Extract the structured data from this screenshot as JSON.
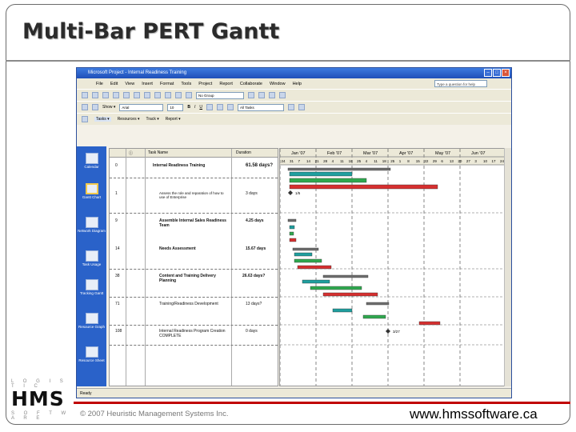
{
  "slide": {
    "title": "Multi-Bar PERT Gantt",
    "copyright": "© 2007 Heuristic Management Systems Inc.",
    "website": "www.hmssoftware.ca",
    "logo": {
      "top": "L O G I S T I C",
      "name": "HMS",
      "bottom": "S O F T W A R E"
    }
  },
  "app": {
    "title": "Microsoft Project - Internal Readiness Training",
    "menu": [
      "File",
      "Edit",
      "View",
      "Insert",
      "Format",
      "Tools",
      "Project",
      "Report",
      "Collaborate",
      "Window",
      "Help"
    ],
    "question_box": "Type a question for help",
    "toolbar": {
      "show_label": "Show ▾",
      "font": "Arial",
      "size": "10",
      "group": "No Group",
      "filter": "All Tasks",
      "bold": "B",
      "italic": "I",
      "underline": "U"
    },
    "guide": [
      "Tasks ▾",
      "Resources ▾",
      "Track ▾",
      "Report ▾"
    ],
    "sidebar": [
      "Calendar",
      "Gantt Chart",
      "Network Diagram",
      "Task Usage",
      "Tracking Gantt",
      "Resource Graph",
      "Resource Sheet"
    ],
    "columns": {
      "task_name": "Task Name",
      "duration": "Duration"
    },
    "rows": [
      {
        "id": "0",
        "name": "Internal Readiness Training",
        "duration": "61.58 days?",
        "bold": true
      },
      {
        "id": "1",
        "name": "Assess the role and reparation of how to use of Enterprise",
        "duration": "3 days",
        "bold": false
      },
      {
        "id": "9",
        "name": "Assemble Internal Sales Readiness Team",
        "duration": "4.25 days",
        "bold": true
      },
      {
        "id": "14",
        "name": "Needs Assessment",
        "duration": "15.67 days",
        "bold": true
      },
      {
        "id": "38",
        "name": "Content and Training Delivery Planning",
        "duration": "26.63 days?",
        "bold": true
      },
      {
        "id": "71",
        "name": "Training/Readiness Development",
        "duration": "13 days?",
        "bold": false
      },
      {
        "id": "108",
        "name": "Internal Readiness Program Creation COMPLETE",
        "duration": "0 days",
        "bold": false
      }
    ],
    "months": [
      "Jan '07",
      "Feb '07",
      "Mar '07",
      "Apr '07",
      "May '07",
      "Jun '07"
    ],
    "days": [
      "24",
      "31",
      "7",
      "14",
      "21",
      "28",
      "4",
      "11",
      "18",
      "25",
      "4",
      "11",
      "18",
      "25",
      "1",
      "8",
      "15",
      "22",
      "29",
      "6",
      "13",
      "20",
      "27",
      "3",
      "10",
      "17",
      "24"
    ],
    "milestone_1": "1/5",
    "milestone_2": "3/27",
    "status": "Ready",
    "colors": {
      "summary": "#6f6f6f",
      "teal": "#1f9e9e",
      "red": "#d62f2f",
      "green": "#2fa84f",
      "sidebar": "#2a62c9"
    }
  }
}
